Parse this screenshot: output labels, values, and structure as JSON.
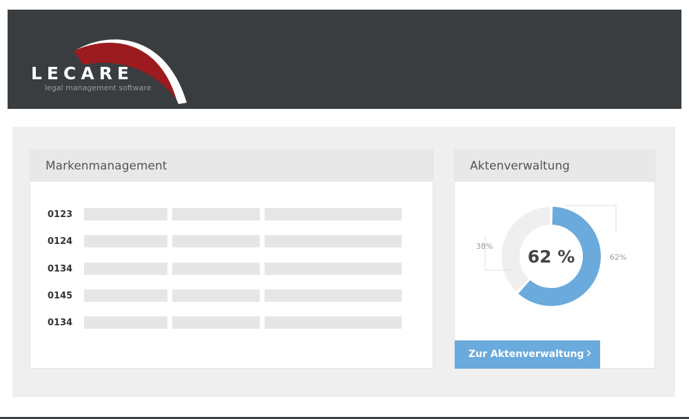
{
  "header": {
    "logo_name": "LECARE",
    "logo_tagline": "legal management software"
  },
  "markenmanagement": {
    "title": "Markenmanagement",
    "rows": [
      {
        "id": "0123"
      },
      {
        "id": "0124"
      },
      {
        "id": "0134"
      },
      {
        "id": "0145"
      },
      {
        "id": "0134"
      }
    ]
  },
  "aktenverwaltung": {
    "title": "Aktenverwaltung",
    "center_label": "62 %",
    "button_label": "Zur Aktenverwaltung",
    "chevron_icon": "chevron-right-icon"
  },
  "chart_data": {
    "type": "pie",
    "variant": "donut",
    "labels": [
      "62%",
      "38%"
    ],
    "values": [
      62,
      38
    ],
    "colors": [
      "#6aaadc",
      "#efefef"
    ]
  }
}
